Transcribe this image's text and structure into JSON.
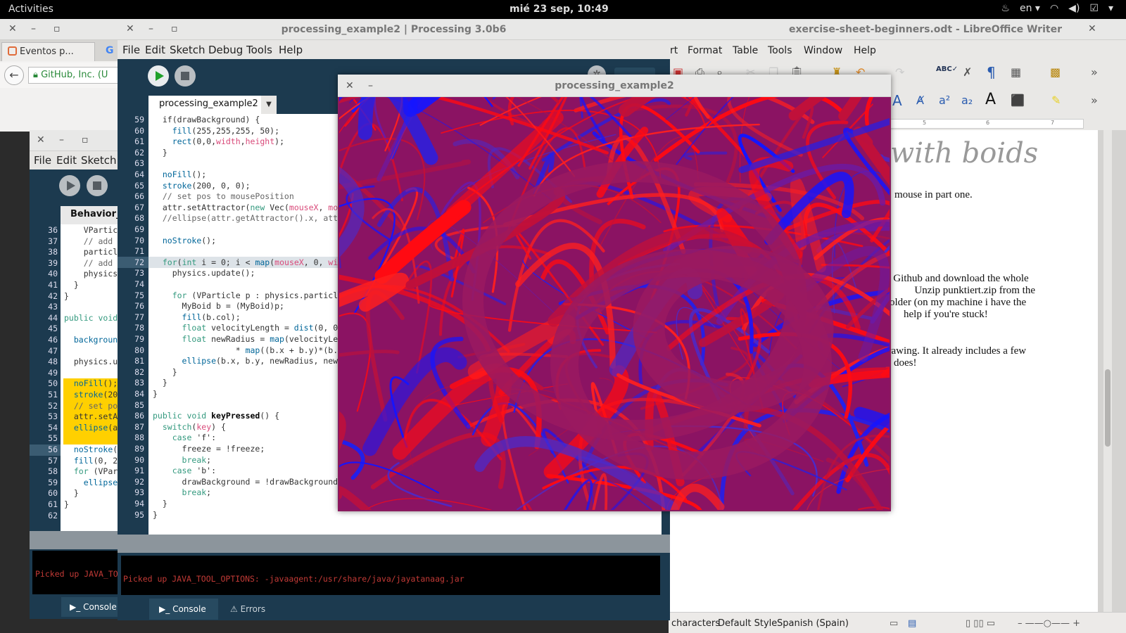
{
  "topbar": {
    "activities": "Activities",
    "clock": "mié 23 sep, 10:49",
    "language": "en",
    "icons": [
      "steam-icon",
      "language-indicator",
      "wifi-icon",
      "volume-icon",
      "clipboard-icon",
      "power-icon"
    ]
  },
  "browser": {
    "tab1_label": "Eventos p...",
    "url_text": "GitHub, Inc. (U"
  },
  "writer": {
    "title": "exercise-sheet-beginners.odt - LibreOffice Writer",
    "menu": [
      "rt",
      "Format",
      "Table",
      "Tools",
      "Window",
      "Help"
    ],
    "handwritten_title": "with boids",
    "paragraphs": [
      "mouse in part one.",
      "n Github and download the whole",
      "Unzip punktiert.zip from the",
      "older (on my machine i have the",
      "help if you're stuck!",
      "drawing. It already includes a few",
      "does!"
    ],
    "ruler_marks": [
      "5",
      "6",
      "7"
    ],
    "status": {
      "chars": "characters",
      "style": "Default Style",
      "lang": "Spanish (Spain)"
    }
  },
  "proc_back": {
    "menu": [
      "File",
      "Edit",
      "Sketch"
    ],
    "tab_label": "Behavior_E",
    "lines": [
      {
        "n": "36",
        "t": "    VPartic"
      },
      {
        "n": "37",
        "t": "    // add"
      },
      {
        "n": "38",
        "t": "    particl"
      },
      {
        "n": "39",
        "t": "    // add"
      },
      {
        "n": "40",
        "t": "    physics"
      },
      {
        "n": "41",
        "t": "  }"
      },
      {
        "n": "42",
        "t": "}"
      },
      {
        "n": "43",
        "t": ""
      },
      {
        "n": "44",
        "t": "public void"
      },
      {
        "n": "45",
        "t": ""
      },
      {
        "n": "46",
        "t": "  backgroun"
      },
      {
        "n": "47",
        "t": ""
      },
      {
        "n": "48",
        "t": "  physics.u"
      },
      {
        "n": "49",
        "t": ""
      },
      {
        "n": "50",
        "t": "  noFill();"
      },
      {
        "n": "51",
        "t": "  stroke(20"
      },
      {
        "n": "52",
        "t": "  // set po"
      },
      {
        "n": "53",
        "t": "  attr.setA"
      },
      {
        "n": "54",
        "t": "  ellipse(a"
      },
      {
        "n": "55",
        "t": ""
      },
      {
        "n": "56",
        "t": "  noStroke("
      },
      {
        "n": "57",
        "t": "  fill(0, 2"
      },
      {
        "n": "58",
        "t": "  for (VPar"
      },
      {
        "n": "59",
        "t": "    ellipse"
      },
      {
        "n": "60",
        "t": "  }"
      },
      {
        "n": "61",
        "t": "}"
      },
      {
        "n": "62",
        "t": ""
      }
    ],
    "console_text": "Picked up JAVA_TO",
    "console_tab": "Console"
  },
  "proc_main": {
    "title": "processing_example2 | Processing 3.0b6",
    "menu": [
      "File",
      "Edit",
      "Sketch",
      "Debug",
      "Tools",
      "Help"
    ],
    "tab_label": "processing_example2",
    "lines": [
      {
        "n": "59",
        "t": "  if(drawBackground) {"
      },
      {
        "n": "60",
        "t": "    fill(255,255,255, 50);"
      },
      {
        "n": "61",
        "t": "    rect(0,0,width,height);"
      },
      {
        "n": "62",
        "t": "  }"
      },
      {
        "n": "63",
        "t": ""
      },
      {
        "n": "64",
        "t": "  noFill();"
      },
      {
        "n": "65",
        "t": "  stroke(200, 0, 0);"
      },
      {
        "n": "66",
        "t": "  // set pos to mousePosition"
      },
      {
        "n": "67",
        "t": "  attr.setAttractor(new Vec(mouseX, mou"
      },
      {
        "n": "68",
        "t": "  //ellipse(attr.getAttractor().x, attr"
      },
      {
        "n": "69",
        "t": ""
      },
      {
        "n": "70",
        "t": "  noStroke();"
      },
      {
        "n": "71",
        "t": ""
      },
      {
        "n": "72",
        "t": "  for(int i = 0; i < map(mouseX, 0, wid"
      },
      {
        "n": "73",
        "t": "    physics.update();"
      },
      {
        "n": "74",
        "t": ""
      },
      {
        "n": "75",
        "t": "    for (VParticle p : physics.particle"
      },
      {
        "n": "76",
        "t": "      MyBoid b = (MyBoid)p;"
      },
      {
        "n": "77",
        "t": "      fill(b.col);"
      },
      {
        "n": "78",
        "t": "      float velocityLength = dist(0, 0"
      },
      {
        "n": "79",
        "t": "      float newRadius = map(velocityLen"
      },
      {
        "n": "80",
        "t": "                 * map((b.x + b.y)*(b.x"
      },
      {
        "n": "81",
        "t": "      ellipse(b.x, b.y, newRadius, newR"
      },
      {
        "n": "82",
        "t": "    }"
      },
      {
        "n": "83",
        "t": "  }"
      },
      {
        "n": "84",
        "t": "}"
      },
      {
        "n": "85",
        "t": ""
      },
      {
        "n": "86",
        "t": "public void keyPressed() {"
      },
      {
        "n": "87",
        "t": "  switch(key) {"
      },
      {
        "n": "88",
        "t": "    case 'f':"
      },
      {
        "n": "89",
        "t": "      freeze = !freeze;"
      },
      {
        "n": "90",
        "t": "      break;"
      },
      {
        "n": "91",
        "t": "    case 'b':"
      },
      {
        "n": "92",
        "t": "      drawBackground = !drawBackground"
      },
      {
        "n": "93",
        "t": "      break;"
      },
      {
        "n": "94",
        "t": "  }"
      },
      {
        "n": "95",
        "t": "}"
      }
    ],
    "console_text": "Picked up JAVA_TOOL_OPTIONS: -javaagent:/usr/share/java/jayatanaag.jar",
    "console_tab": "Console",
    "errors_tab": "Errors"
  },
  "sketch": {
    "title": "processing_example2"
  },
  "colors": {
    "processing_bg": "#1c3a4f",
    "console_text": "#c23a36",
    "sketch_red": "#ff0a12",
    "sketch_blue": "#1515ff",
    "sketch_magenta": "#8b1363"
  }
}
